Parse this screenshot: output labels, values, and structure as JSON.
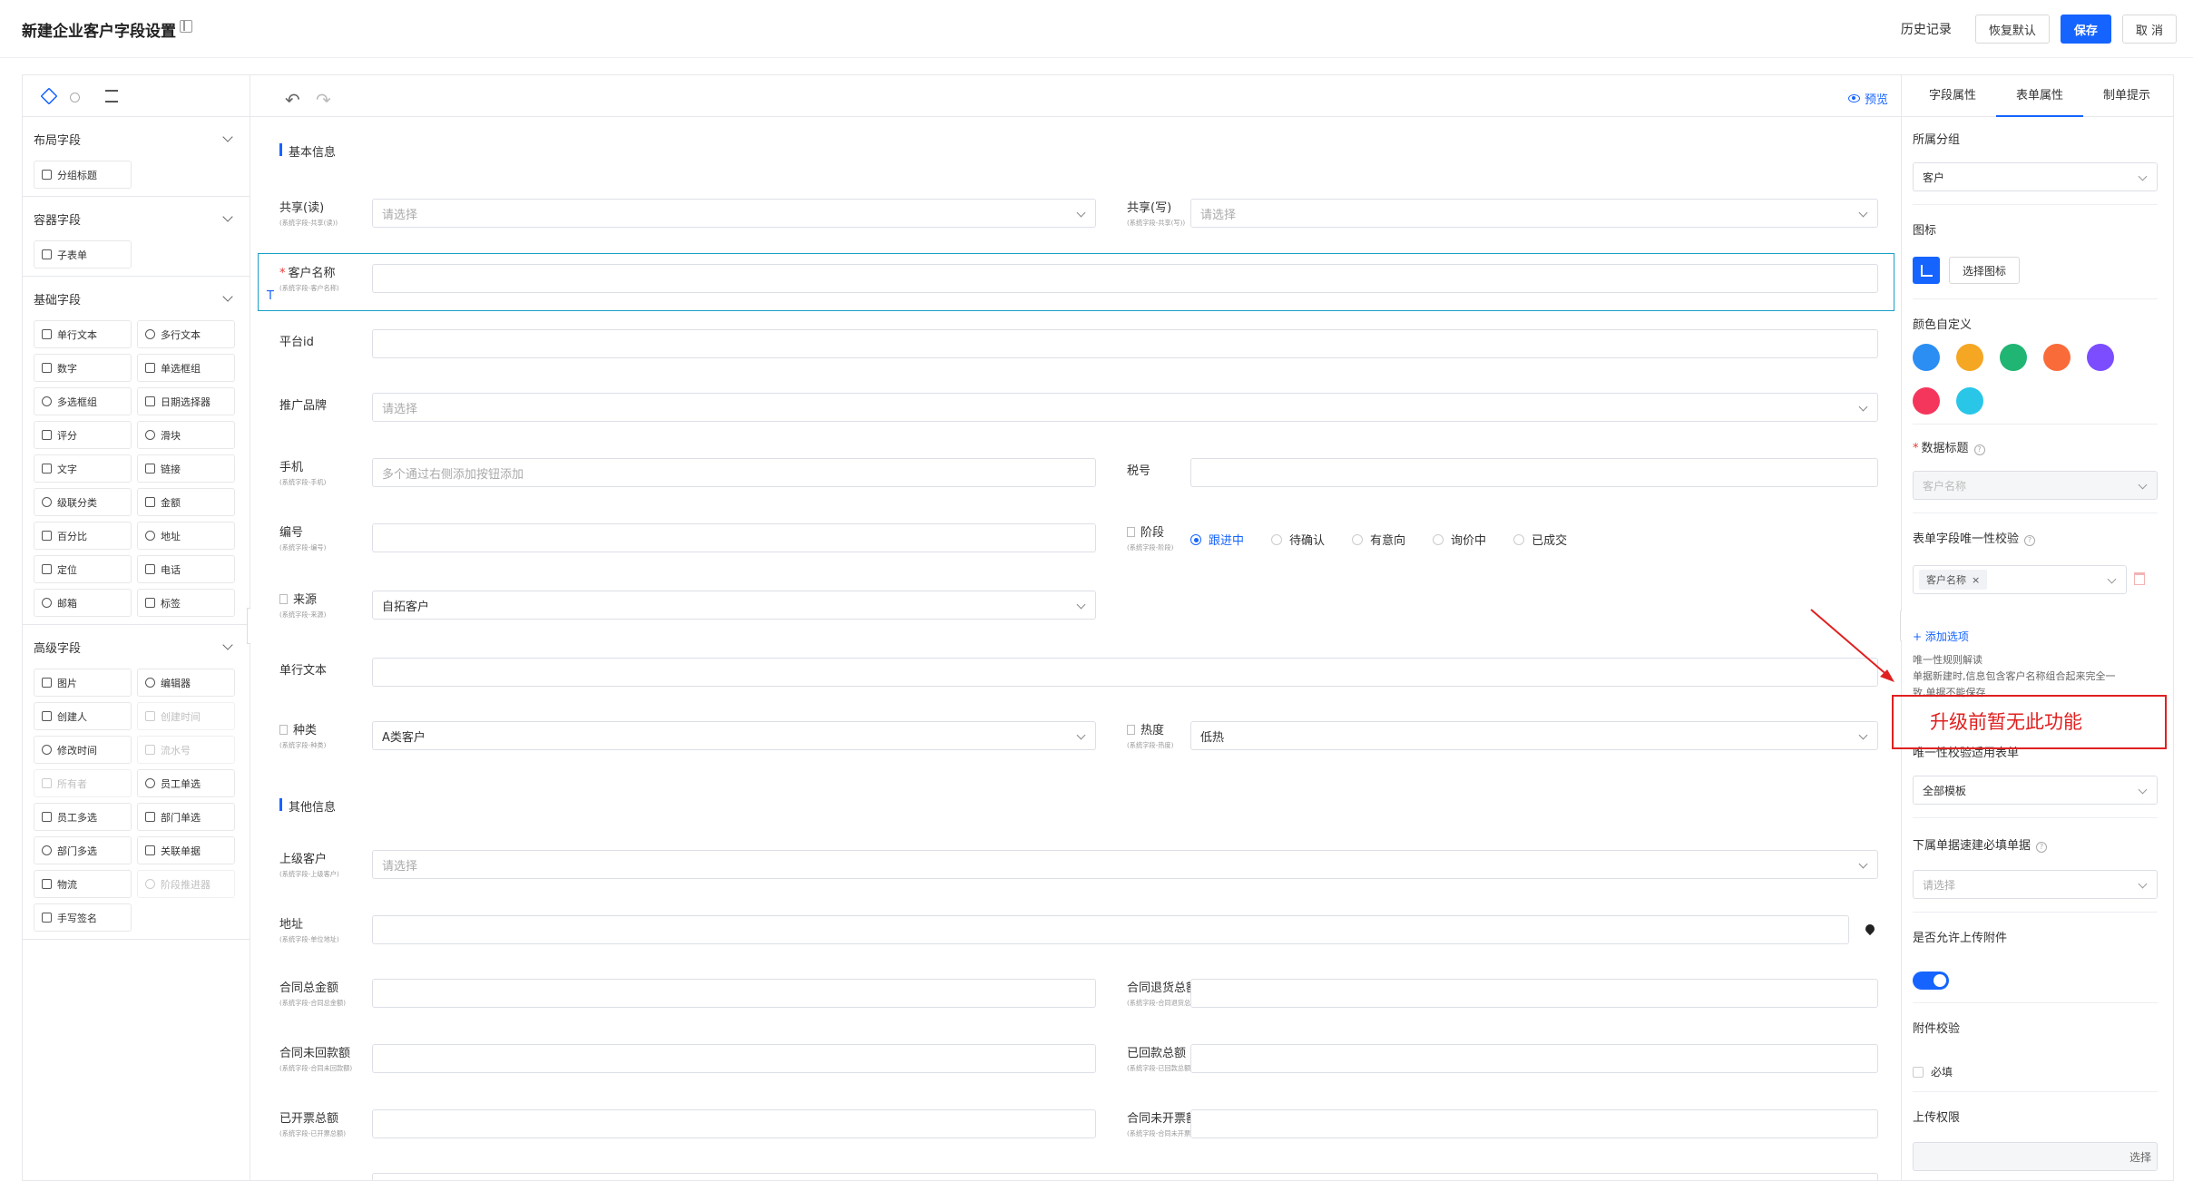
{
  "header": {
    "title": "新建企业客户字段设置",
    "history": "历史记录",
    "restore": "恢复默认",
    "save": "保存",
    "cancel": "取 消"
  },
  "left": {
    "groups": [
      {
        "title": "布局字段",
        "items": [
          {
            "label": "分组标题",
            "disabled": false
          }
        ]
      },
      {
        "title": "容器字段",
        "items": [
          {
            "label": "子表单",
            "disabled": false
          }
        ]
      },
      {
        "title": "基础字段",
        "items": [
          {
            "label": "单行文本",
            "disabled": false
          },
          {
            "label": "多行文本",
            "disabled": false
          },
          {
            "label": "数字",
            "disabled": false
          },
          {
            "label": "单选框组",
            "disabled": false
          },
          {
            "label": "多选框组",
            "disabled": false
          },
          {
            "label": "日期选择器",
            "disabled": false
          },
          {
            "label": "评分",
            "disabled": false
          },
          {
            "label": "滑块",
            "disabled": false
          },
          {
            "label": "文字",
            "disabled": false
          },
          {
            "label": "链接",
            "disabled": false
          },
          {
            "label": "级联分类",
            "disabled": false
          },
          {
            "label": "金额",
            "disabled": false
          },
          {
            "label": "百分比",
            "disabled": false
          },
          {
            "label": "地址",
            "disabled": false
          },
          {
            "label": "定位",
            "disabled": false
          },
          {
            "label": "电话",
            "disabled": false
          },
          {
            "label": "邮箱",
            "disabled": false
          },
          {
            "label": "标签",
            "disabled": false
          }
        ]
      },
      {
        "title": "高级字段",
        "items": [
          {
            "label": "图片",
            "disabled": false
          },
          {
            "label": "编辑器",
            "disabled": false
          },
          {
            "label": "创建人",
            "disabled": false
          },
          {
            "label": "创建时间",
            "disabled": true
          },
          {
            "label": "修改时间",
            "disabled": false
          },
          {
            "label": "流水号",
            "disabled": true
          },
          {
            "label": "所有者",
            "disabled": true
          },
          {
            "label": "员工单选",
            "disabled": false
          },
          {
            "label": "员工多选",
            "disabled": false
          },
          {
            "label": "部门单选",
            "disabled": false
          },
          {
            "label": "部门多选",
            "disabled": false
          },
          {
            "label": "关联单据",
            "disabled": false
          },
          {
            "label": "物流",
            "disabled": false
          },
          {
            "label": "阶段推进器",
            "disabled": true
          },
          {
            "label": "手写签名",
            "disabled": false
          }
        ]
      }
    ]
  },
  "canvas": {
    "preview": "预览",
    "section_basic": "基本信息",
    "section_other": "其他信息",
    "placeholder_select": "请选择",
    "share_read": {
      "label": "共享(读)",
      "sub": "(系统字段-共享(读))"
    },
    "share_write": {
      "label": "共享(写)",
      "sub": "(系统字段-共享(写))"
    },
    "customer_name": {
      "label": "客户名称",
      "sub": "(系统字段-客户名称)"
    },
    "platform_id": {
      "label": "平台id"
    },
    "brand": {
      "label": "推广品牌"
    },
    "phone": {
      "label": "手机",
      "sub": "(系统字段-手机)",
      "placeholder": "多个通过右侧添加按钮添加"
    },
    "tax": {
      "label": "税号"
    },
    "code": {
      "label": "编号",
      "sub": "(系统字段-编号)"
    },
    "stage": {
      "label": "阶段",
      "sub": "(系统字段-阶段)",
      "options": [
        "跟进中",
        "待确认",
        "有意向",
        "询价中",
        "已成交"
      ],
      "selected": "跟进中"
    },
    "source": {
      "label": "来源",
      "sub": "(系统字段-来源)",
      "value": "自拓客户"
    },
    "single_text": {
      "label": "单行文本"
    },
    "kind": {
      "label": "种类",
      "sub": "(系统字段-种类)",
      "value": "A类客户"
    },
    "heat": {
      "label": "热度",
      "sub": "(系统字段-热度)",
      "value": "低热"
    },
    "parent": {
      "label": "上级客户",
      "sub": "(系统字段-上级客户)"
    },
    "address": {
      "label": "地址",
      "sub": "(系统字段-单位地址)"
    },
    "contract_total": {
      "label": "合同总金额",
      "sub": "(系统字段-合同总金额)"
    },
    "contract_return": {
      "label": "合同退货总额",
      "sub": "(系统字段-合同退货总额)"
    },
    "contract_unpaid": {
      "label": "合同未回款额",
      "sub": "(系统字段-合同未回款额)"
    },
    "paid_total": {
      "label": "已回款总额",
      "sub": "(系统字段-已回款总额)"
    },
    "invoiced": {
      "label": "已开票总额",
      "sub": "(系统字段-已开票总额)"
    },
    "uninvoiced": {
      "label": "合同未开票额",
      "sub": "(系统字段-合同未开票额)"
    }
  },
  "right": {
    "tabs": [
      "字段属性",
      "表单属性",
      "制单提示"
    ],
    "group_label": "所属分组",
    "group_value": "客户",
    "icon_label": "图标",
    "icon_button": "选择图标",
    "color_label": "颜色自定义",
    "colors": [
      "#2b8ef3",
      "#f5a623",
      "#21b573",
      "#fa6b3a",
      "#7c4dff",
      "#f5365c",
      "#29c6e8"
    ],
    "data_title_label": "数据标题",
    "data_title_value": "客户名称",
    "unique_label": "表单字段唯一性校验",
    "unique_tag": "客户名称",
    "add_option": "+ 添加选项",
    "unique_note1": "唯一性规则解读",
    "unique_note2": "单据新建时,信息包含客户名称组合起来完全一",
    "unique_note3": "致,单据不能保存",
    "scope_label": "唯一性校验适用表单",
    "scope_value": "全部模板",
    "required_label": "下属单据速建必填单据",
    "required_placeholder": "请选择",
    "upload_label": "是否允许上传附件",
    "attach_check_label": "附件校验",
    "required_check": "必填",
    "upload_perm_label": "上传权限",
    "upload_perm_button": "选择"
  },
  "annotation": {
    "text": "升级前暂无此功能"
  }
}
